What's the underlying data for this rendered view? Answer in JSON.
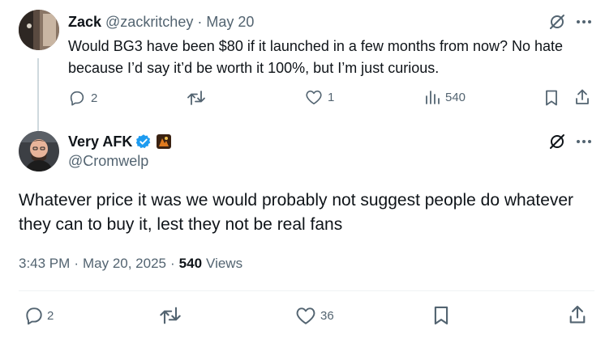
{
  "parent_tweet": {
    "author_name": "Zack",
    "handle": "@zackritchey",
    "separator": "·",
    "date": "May 20",
    "text": "Would BG3 have been $80 if it launched in a few months from now? No hate because I’d say it’d be worth it 100%, but I’m just curious.",
    "replies": "2",
    "retweets": "",
    "likes": "1",
    "views": "540"
  },
  "main_tweet": {
    "author_name": "Very AFK",
    "handle": "@Cromwelp",
    "text": "Whatever price it was we would probably not suggest people do whatever they can to buy it, lest they not be real fans",
    "time": "3:43 PM",
    "separator": "·",
    "date": "May 20, 2025",
    "separator2": "·",
    "views_count": "540",
    "views_label": "Views",
    "replies": "2",
    "retweets": "",
    "likes": "36"
  },
  "colors": {
    "text": "#0f1419",
    "secondary": "#536471",
    "verified_blue": "#1d9bf0",
    "thread_line": "#cfd9de"
  },
  "icons": [
    "grok-icon",
    "more-icon",
    "reply-icon",
    "retweet-icon",
    "like-icon",
    "views-icon",
    "bookmark-icon",
    "share-icon",
    "verified-icon"
  ]
}
